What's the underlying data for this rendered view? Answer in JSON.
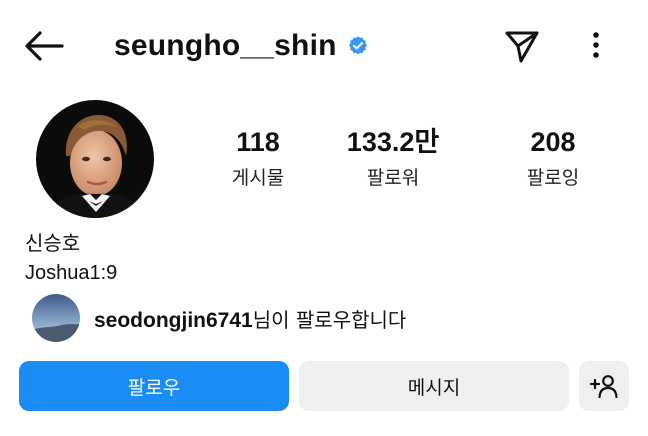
{
  "header": {
    "username": "seungho__shin",
    "verified": true,
    "icons": [
      "back-arrow-icon",
      "verified-badge-icon",
      "send-icon",
      "more-vert-icon"
    ]
  },
  "stats": [
    {
      "value": "118",
      "label": "게시물"
    },
    {
      "value": "133.2만",
      "label": "팔로워"
    },
    {
      "value": "208",
      "label": "팔로잉"
    }
  ],
  "profile": {
    "full_name": "신승호",
    "bio": "Joshua1:9"
  },
  "followed_by": {
    "username": "seodongjin6741",
    "suffix": "님이 팔로우합니다"
  },
  "actions": {
    "follow_label": "팔로우",
    "message_label": "메시지"
  },
  "colors": {
    "accent": "#1a8cf5",
    "verified": "#3897f0",
    "secondary_button": "#efefef"
  }
}
